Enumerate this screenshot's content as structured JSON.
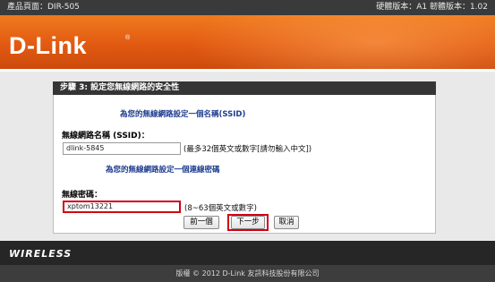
{
  "topbar": {
    "product_page": "產品頁面：DIR-505",
    "versions": "硬體版本：A1   韌體版本：1.02"
  },
  "brand": {
    "logo_text": "D-Link",
    "trademark": "®"
  },
  "wizard": {
    "header": "步驟 3: 設定您無線網路的安全性",
    "ssid_section_title": "為您的無線網路設定一個名稱(SSID)",
    "ssid_label": "無線網路名稱 (SSID)：",
    "ssid_value": "dlink-5845",
    "ssid_hint": "(最多32個英文或數字[請勿輸入中文])",
    "password_section_title": "為您的無線網路設定一個連線密碼",
    "password_label": "無線密碼：",
    "password_value": "xptom13221",
    "password_hint": "(8~63個英文或數字)",
    "prev_button": "前一個",
    "next_button": "下一步",
    "cancel_button": "取消"
  },
  "wireless_label": "WIRELESS",
  "footer": {
    "copyright": "版權 © 2012 D-Link 友訊科技股份有限公司"
  },
  "colors": {
    "banner_orange": "#e25a12",
    "highlight_red": "#d30012",
    "section_title_blue": "#1d3c8f"
  }
}
